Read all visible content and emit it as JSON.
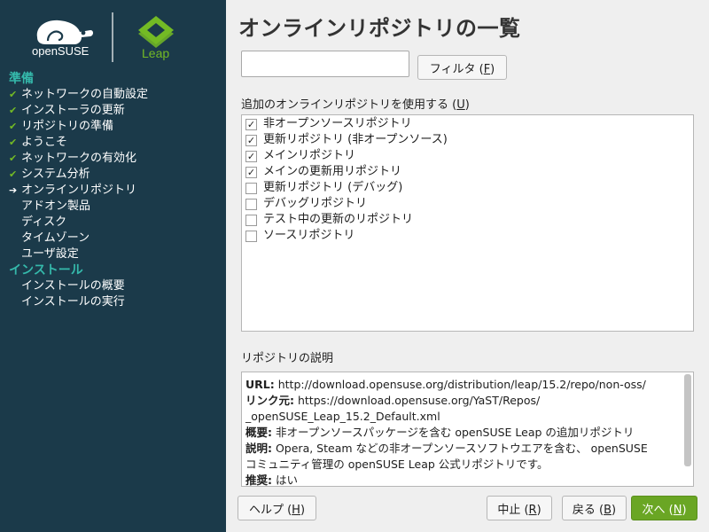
{
  "branding": {
    "opensuse_logo_text": "openSUSE",
    "leap_logo_text": "Leap"
  },
  "sidebar": {
    "sections": [
      {
        "title": "準備",
        "steps": [
          {
            "label": "ネットワークの自動設定",
            "status": "done"
          },
          {
            "label": "インストーラの更新",
            "status": "done"
          },
          {
            "label": "リポジトリの準備",
            "status": "done"
          },
          {
            "label": "ようこそ",
            "status": "done"
          },
          {
            "label": "ネットワークの有効化",
            "status": "done"
          },
          {
            "label": "システム分析",
            "status": "done"
          },
          {
            "label": "オンラインリポジトリ",
            "status": "current"
          },
          {
            "label": "アドオン製品",
            "status": "pending"
          },
          {
            "label": "ディスク",
            "status": "pending"
          },
          {
            "label": "タイムゾーン",
            "status": "pending"
          },
          {
            "label": "ユーザ設定",
            "status": "pending"
          }
        ]
      },
      {
        "title": "インストール",
        "steps": [
          {
            "label": "インストールの概要",
            "status": "pending"
          },
          {
            "label": "インストールの実行",
            "status": "pending"
          }
        ]
      }
    ]
  },
  "main": {
    "title": "オンラインリポジトリの一覧",
    "search": {
      "value": "",
      "placeholder": ""
    },
    "filter_button": {
      "label": "フィルタ (",
      "key": "F",
      "suffix": ")"
    },
    "list_label": {
      "text": "追加のオンラインリポジトリを使用する (",
      "key": "U",
      "suffix": ")"
    },
    "repositories": [
      {
        "name": "非オープンソースリポジトリ",
        "checked": true
      },
      {
        "name": "更新リポジトリ (非オープンソース)",
        "checked": true
      },
      {
        "name": "メインリポジトリ",
        "checked": true
      },
      {
        "name": "メインの更新用リポジトリ",
        "checked": true
      },
      {
        "name": "更新リポジトリ (デバッグ)",
        "checked": false
      },
      {
        "name": "デバッグリポジトリ",
        "checked": false
      },
      {
        "name": "テスト中の更新のリポジトリ",
        "checked": false
      },
      {
        "name": "ソースリポジトリ",
        "checked": false
      }
    ],
    "description_label": "リポジトリの説明",
    "description": [
      {
        "key": "URL:",
        "value": " http://download.opensuse.org/distribution/leap/15.2/repo/non-oss/"
      },
      {
        "key": "リンク元:",
        "value": " https://download.opensuse.org/YaST/Repos/"
      },
      {
        "key": "",
        "value": "_openSUSE_Leap_15.2_Default.xml"
      },
      {
        "key": "概要:",
        "value": " 非オープンソースパッケージを含む openSUSE Leap の追加リポジトリ"
      },
      {
        "key": "説明:",
        "value": " Opera, Steam などの非オープンソースソフトウエアを含む、 openSUSE"
      },
      {
        "key": "",
        "value": "コミュニティ管理の openSUSE Leap 公式リポジトリです。"
      },
      {
        "key": "推奨:",
        "value": " はい"
      }
    ]
  },
  "buttons": {
    "help": {
      "label": "ヘルプ (",
      "key": "H",
      "suffix": ")"
    },
    "abort": {
      "label": "中止 (",
      "key": "R",
      "suffix": ")"
    },
    "back": {
      "label": "戻る (",
      "key": "B",
      "suffix": ")"
    },
    "next": {
      "label": "次へ (",
      "key": "N",
      "suffix": ")"
    }
  },
  "colors": {
    "sidebar_bg": "#1b3a4a",
    "accent_teal": "#35b9ab",
    "accent_green": "#73ba25",
    "next_button": "#6aa624"
  },
  "icons": {
    "done": "checkmark-icon",
    "current": "arrow-right-icon"
  }
}
